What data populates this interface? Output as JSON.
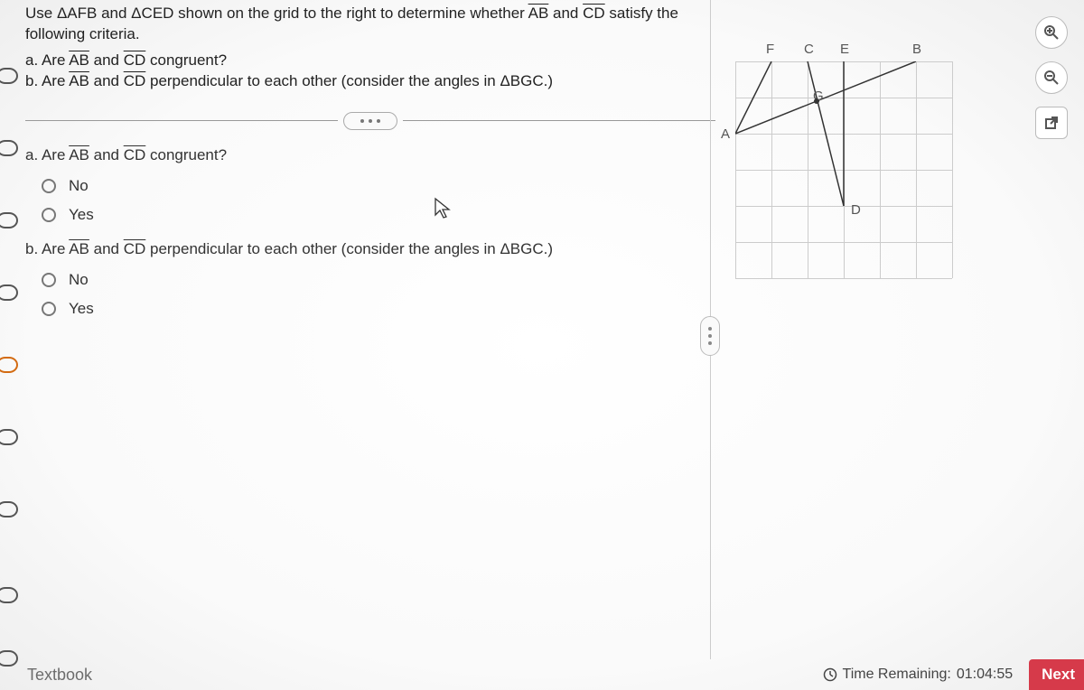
{
  "problem": {
    "intro_part1": "Use ΔAFB and ΔCED shown on the grid to the right to determine whether ",
    "seg_ab": "AB",
    "intro_and": " and ",
    "seg_cd": "CD",
    "intro_part2": " satisfy the following criteria.",
    "a_label": "a. Are ",
    "a_mid": " and ",
    "a_tail": " congruent?",
    "b_label": "b. Are ",
    "b_mid": " and ",
    "b_tail": " perpendicular to each other (consider the angles in ΔBGC.)"
  },
  "questions": {
    "a": {
      "title_pre": "a. Are ",
      "title_mid": " and ",
      "title_post": " congruent?",
      "options": [
        "No",
        "Yes"
      ]
    },
    "b": {
      "title_pre": "b. Are ",
      "title_mid": " and ",
      "title_post": " perpendicular to each other (consider the angles in ΔBGC.)",
      "options": [
        "No",
        "Yes"
      ]
    }
  },
  "grid": {
    "labels": {
      "A": "A",
      "B": "B",
      "C": "C",
      "D": "D",
      "E": "E",
      "F": "F",
      "G": "G"
    }
  },
  "footer": {
    "textbook": "Textbook",
    "time_label": "Time Remaining:",
    "time_value": "01:04:55",
    "next": "Next"
  }
}
